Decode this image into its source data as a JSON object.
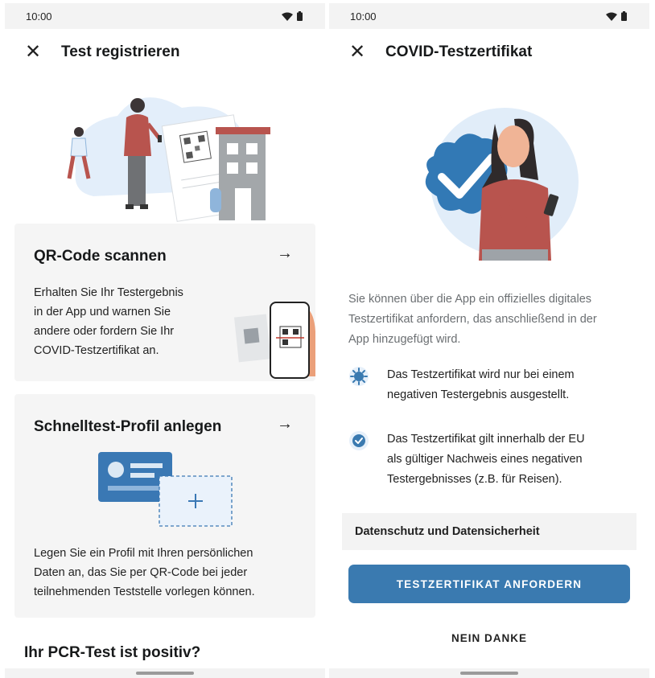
{
  "status": {
    "time": "10:00",
    "wifi_icon": "wifi-icon",
    "battery_icon": "battery-icon"
  },
  "left": {
    "title": "Test registrieren",
    "close_icon": "close-icon",
    "qr_card": {
      "title": "QR-Code scannen",
      "text_lines": [
        "Erhalten Sie Ihr Testergebnis",
        "in der App und warnen Sie",
        "andere oder fordern Sie Ihr",
        "COVID-Testzertifikat an."
      ]
    },
    "profile_card": {
      "title": "Schnelltest-Profil anlegen",
      "text_lines": [
        "Legen Sie ein Profil mit Ihren persönlichen",
        "Daten an, das Sie per QR-Code bei jeder",
        "teilnehmenden Teststelle vorlegen können."
      ]
    },
    "next_heading": "Ihr PCR-Test ist positiv?"
  },
  "right": {
    "title": "COVID-Testzertifikat",
    "close_icon": "close-icon",
    "intro_lines": [
      "Sie können über die App ein offizielles digitales",
      "Testzertifikat anfordern, das anschließend in der",
      "App hinzugefügt wird."
    ],
    "bullets": [
      {
        "icon": "virus-icon",
        "lines": [
          "Das Testzertifikat wird nur bei einem",
          "negativen Testergebnis ausgestellt."
        ]
      },
      {
        "icon": "verified-badge-icon",
        "lines": [
          "Das Testzertifikat gilt innerhalb der EU",
          "als gültiger Nachweis eines negativen",
          "Testergebnisses (z.B. für Reisen)."
        ]
      }
    ],
    "privacy_label": "Datenschutz und Datensicherheit",
    "primary_button": "TESTZERTIFIKAT ANFORDERN",
    "secondary_button": "NEIN DANKE"
  },
  "colors": {
    "accent": "#3a7ab0",
    "illustration_blue": "#3279b5",
    "light_blue": "#e1edf9",
    "clothing": "#b8544e",
    "card_bg": "#f5f5f5"
  }
}
